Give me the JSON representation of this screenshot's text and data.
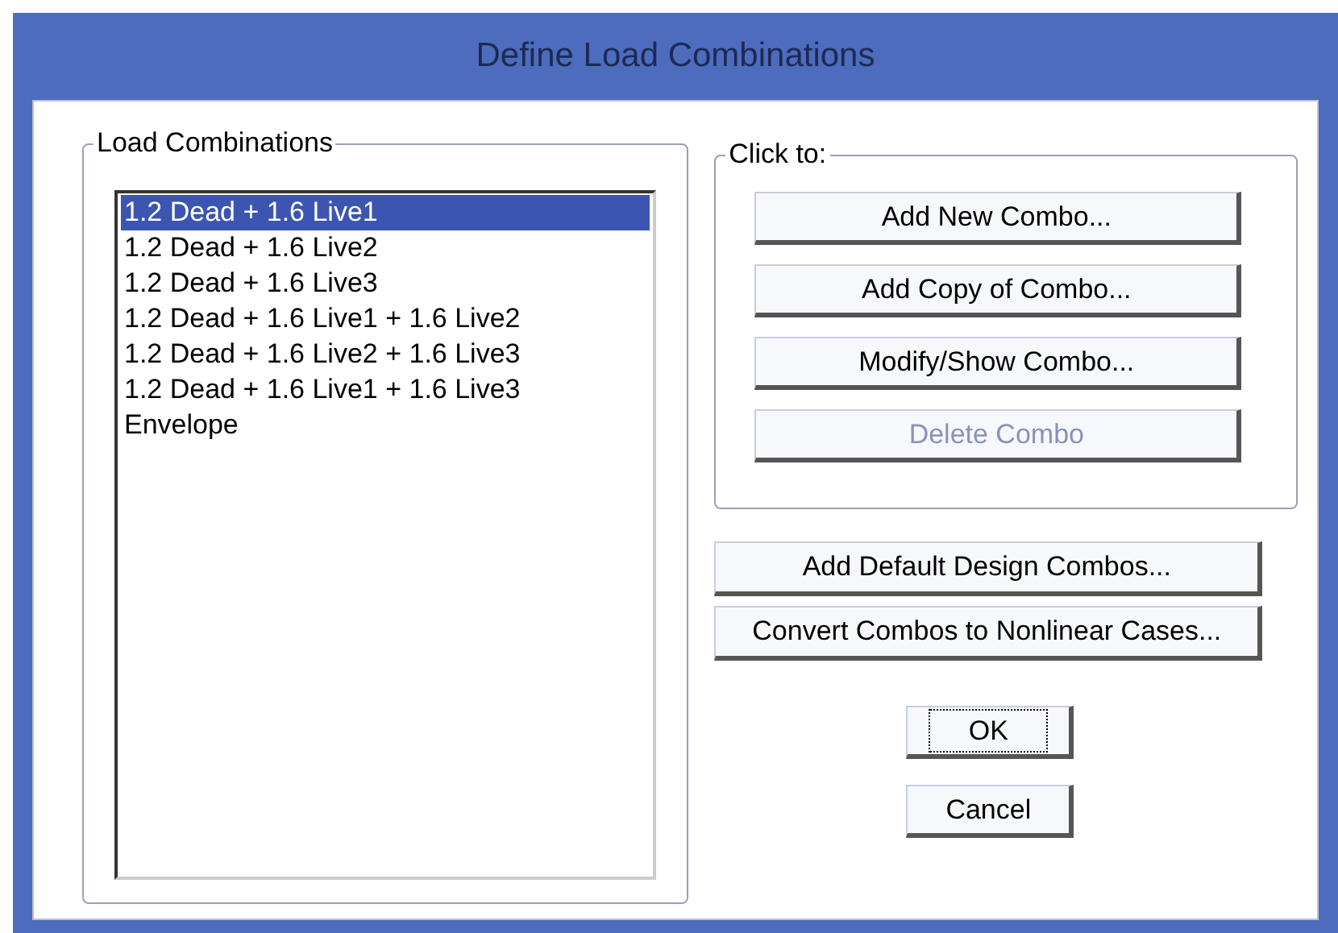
{
  "window": {
    "title": "Define Load Combinations"
  },
  "load_combinations": {
    "label": "Load Combinations",
    "items": [
      {
        "label": "1.2 Dead + 1.6 Live1",
        "selected": true
      },
      {
        "label": "1.2 Dead + 1.6 Live2",
        "selected": false
      },
      {
        "label": "1.2 Dead + 1.6 Live3",
        "selected": false
      },
      {
        "label": "1.2 Dead + 1.6 Live1 + 1.6 Live2",
        "selected": false
      },
      {
        "label": "1.2 Dead + 1.6 Live2 + 1.6 Live3",
        "selected": false
      },
      {
        "label": "1.2 Dead + 1.6 Live1 + 1.6 Live3",
        "selected": false
      },
      {
        "label": "Envelope",
        "selected": false
      }
    ]
  },
  "click_to": {
    "label": "Click to:",
    "buttons": [
      {
        "label": "Add New Combo...",
        "disabled": false
      },
      {
        "label": "Add Copy of Combo...",
        "disabled": false
      },
      {
        "label": "Modify/Show Combo...",
        "disabled": false
      },
      {
        "label": "Delete Combo",
        "disabled": true
      }
    ]
  },
  "extra_buttons": [
    {
      "label": "Add Default Design Combos..."
    },
    {
      "label": "Convert Combos to Nonlinear Cases..."
    }
  ],
  "dialog_buttons": [
    {
      "label": "OK",
      "focused": true
    },
    {
      "label": "Cancel",
      "focused": false
    }
  ]
}
